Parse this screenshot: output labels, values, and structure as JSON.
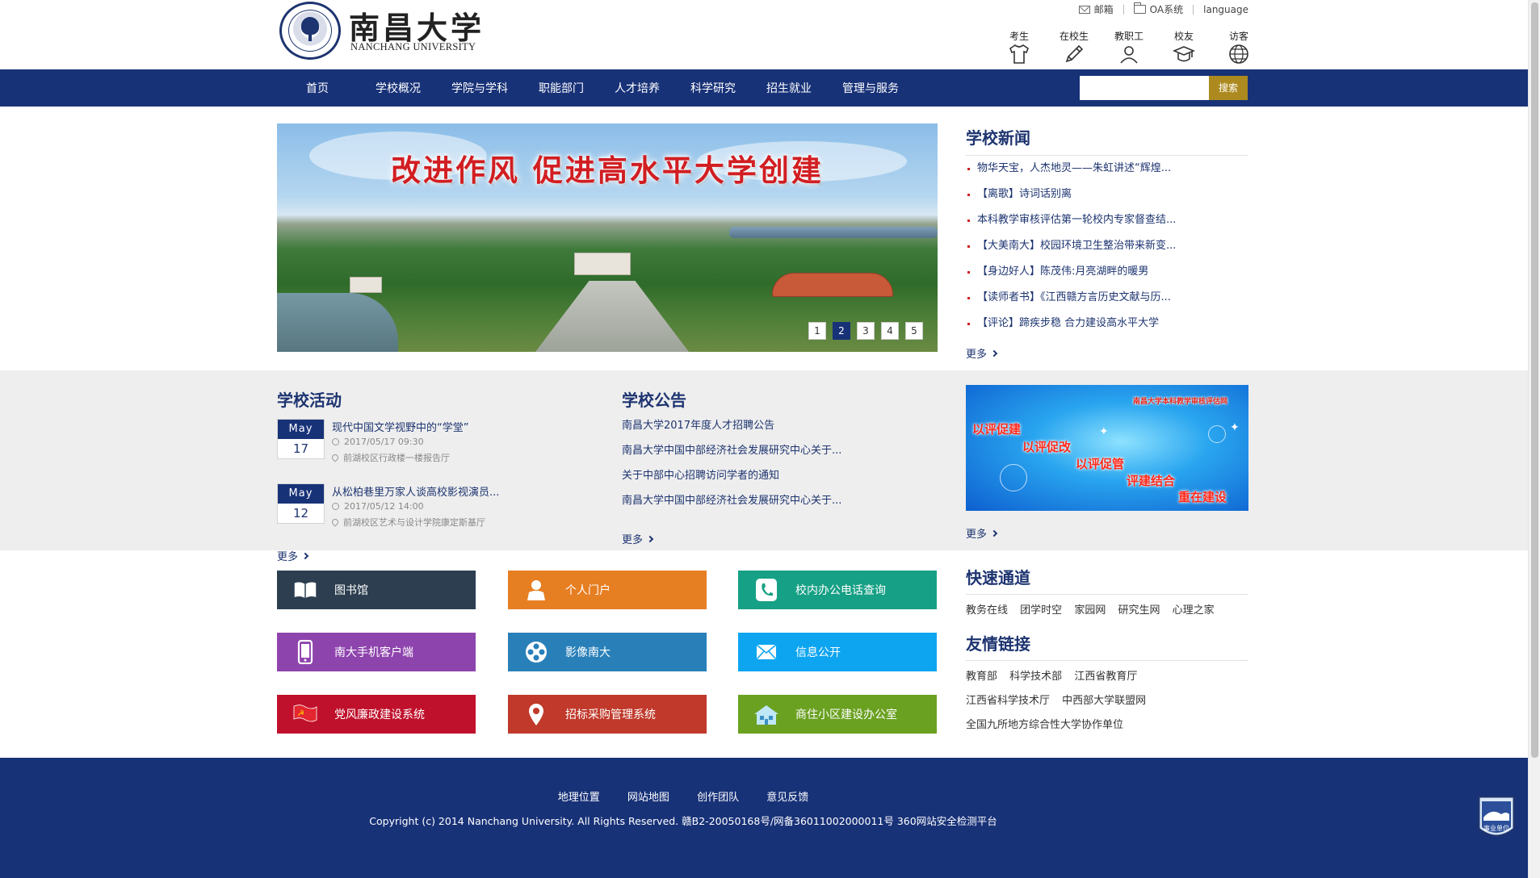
{
  "header": {
    "logo_cn": "南昌大学",
    "logo_en": "NANCHANG UNIVERSITY",
    "top_links": {
      "mail": "邮箱",
      "oa": "OA系统",
      "language": "language"
    },
    "user_links": [
      {
        "label": "考生",
        "icon": "shirt-icon"
      },
      {
        "label": "在校生",
        "icon": "pencil-icon"
      },
      {
        "label": "教职工",
        "icon": "person-icon"
      },
      {
        "label": "校友",
        "icon": "graduation-cap-icon"
      },
      {
        "label": "访客",
        "icon": "globe-icon"
      }
    ]
  },
  "nav": {
    "items": [
      "首页",
      "学校概况",
      "学院与学科",
      "职能部门",
      "人才培养",
      "科学研究",
      "招生就业",
      "管理与服务"
    ],
    "search_value": "",
    "search_button": "搜索"
  },
  "banner": {
    "slogan": "改进作风 促进高水平大学创建",
    "pages": [
      "1",
      "2",
      "3",
      "4",
      "5"
    ],
    "active_page": "2"
  },
  "news": {
    "title": "学校新闻",
    "items": [
      "物华天宝，人杰地灵——朱虹讲述“辉煌...",
      "【离歌】诗词话别离",
      "本科教学审核评估第一轮校内专家督查结...",
      "【大美南大】校园环境卫生整治带来新变...",
      "【身边好人】陈茂伟:月亮湖畔的暖男",
      "【读师者书】《江西赣方言历史文献与历...",
      "【评论】蹄疾步稳 合力建设高水平大学"
    ],
    "more": "更多"
  },
  "activities": {
    "title": "学校活动",
    "items": [
      {
        "month": "May",
        "day": "17",
        "title": "现代中国文学视野中的“学堂”",
        "time": "2017/05/17 09:30",
        "location": "前湖校区行政楼一楼报告厅"
      },
      {
        "month": "May",
        "day": "12",
        "title": "从松柏巷里万家人谈高校影视演员...",
        "time": "2017/05/12 14:00",
        "location": "前湖校区艺术与设计学院康定斯基厅"
      }
    ],
    "more": "更多"
  },
  "announcements": {
    "title": "学校公告",
    "items": [
      "南昌大学2017年度人才招聘公告",
      "南昌大学中国中部经济社会发展研究中心关于...",
      "关于中部中心招聘访问学者的通知",
      "南昌大学中国中部经济社会发展研究中心关于..."
    ],
    "more": "更多"
  },
  "promo": {
    "tag": "南昌大学本科教学审核评估网",
    "slogans": [
      "以评促建",
      "以评促改",
      "以评促管",
      "评建结合",
      "重在建设"
    ],
    "more": "更多"
  },
  "tiles": [
    {
      "label": "图书馆",
      "color": "#2d3e50",
      "icon": "book-icon"
    },
    {
      "label": "个人门户",
      "color": "#e67e22",
      "icon": "user-icon"
    },
    {
      "label": "校内办公电话查询",
      "color": "#16a085",
      "icon": "phone-icon"
    },
    {
      "label": "南大手机客户端",
      "color": "#8e44ad",
      "icon": "mobile-icon"
    },
    {
      "label": "影像南大",
      "color": "#2980b9",
      "icon": "film-reel-icon"
    },
    {
      "label": "信息公开",
      "color": "#0ea5f0",
      "icon": "envelope-icon"
    },
    {
      "label": "党风廉政建设系统",
      "color": "#c0112c",
      "icon": "party-flag-icon"
    },
    {
      "label": "招标采购管理系统",
      "color": "#c0392b",
      "icon": "location-pin-icon"
    },
    {
      "label": "商住小区建设办公室",
      "color": "#6aa121",
      "icon": "building-icon"
    }
  ],
  "quick": {
    "title": "快速通道",
    "links": [
      "教务在线",
      "团学时空",
      "家园网",
      "研究生网",
      "心理之家"
    ]
  },
  "friend": {
    "title": "友情链接",
    "rows": [
      [
        "教育部",
        "科学技术部",
        "江西省教育厅"
      ],
      [
        "江西省科学技术厅",
        "中西部大学联盟网"
      ],
      [
        "全国九所地方综合性大学协作单位"
      ]
    ]
  },
  "footer": {
    "links": [
      "地理位置",
      "网站地图",
      "创作团队",
      "意见反馈"
    ],
    "copyright": "Copyright (c) 2014 Nanchang University. All Rights Reserved. 赣B2-20050168号/网备36011002000011号 360网站安全检测平台",
    "badge": "事业单位"
  }
}
